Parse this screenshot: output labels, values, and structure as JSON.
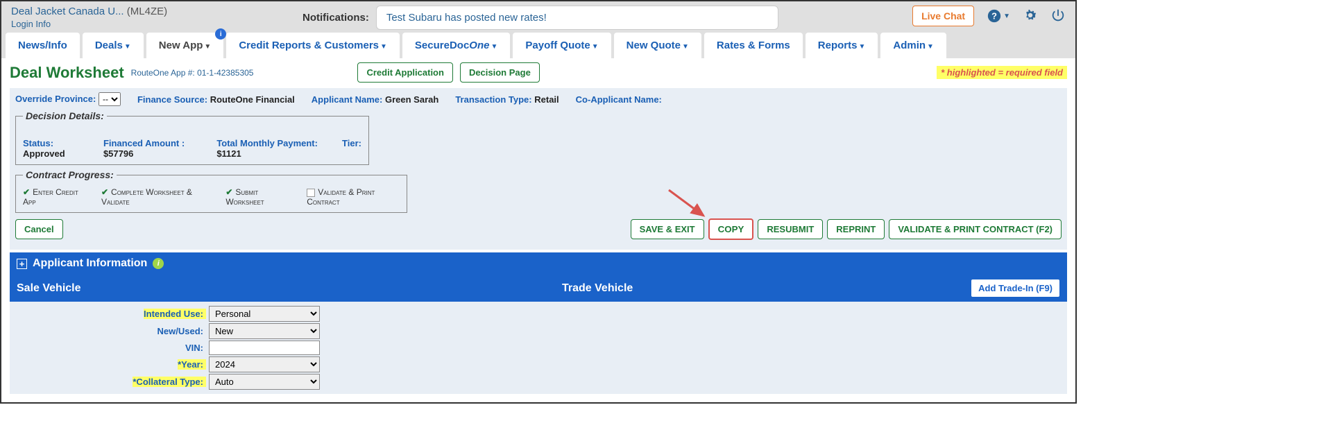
{
  "breadcrumb": {
    "parts": "Deal Jacket Canada U...",
    "code": "(ML4ZE)"
  },
  "login_info": "Login Info",
  "notifications": {
    "label": "Notifications:",
    "text": "Test Subaru has posted new rates!"
  },
  "live_chat": "Live Chat",
  "tabs": {
    "news": "News/Info",
    "deals": "Deals",
    "newapp": "New App",
    "credit": "Credit Reports & Customers",
    "securedoc_prefix": "SecureDoc",
    "securedoc_suffix": "One",
    "payoff": "Payoff Quote",
    "newquote": "New Quote",
    "rates": "Rates & Forms",
    "reports": "Reports",
    "admin": "Admin",
    "badge": "i"
  },
  "page": {
    "title": "Deal Worksheet",
    "appnum_label": "RouteOne App #: ",
    "appnum": "01-1-42385305",
    "credit_app_btn": "Credit Application",
    "decision_btn": "Decision Page",
    "required_note": "* highlighted = required field"
  },
  "strip": {
    "override_label": "Override Province:",
    "override_val": "--",
    "fs_label": "Finance Source:",
    "fs_val": "RouteOne Financial",
    "applicant_label": "Applicant Name:",
    "applicant_val": "Green Sarah",
    "ttype_label": "Transaction Type:",
    "ttype_val": "Retail",
    "coapp_label": "Co-Applicant Name:",
    "coapp_val": ""
  },
  "decision": {
    "legend": "Decision Details:",
    "status_label": "Status:",
    "status_val": "Approved",
    "financed_label": "Financed Amount :",
    "financed_val": "$57796",
    "monthly_label": "Total Monthly Payment:",
    "monthly_val": "$1121",
    "tier_label": "Tier:",
    "tier_val": ""
  },
  "progress": {
    "legend": "Contract Progress:",
    "s1": "Enter Credit App",
    "s2": "Complete Worksheet & Validate",
    "s3": "Submit Worksheet",
    "s4": "Validate & Print Contract"
  },
  "actions": {
    "cancel": "Cancel",
    "save_exit": "SAVE & EXIT",
    "copy": "COPY",
    "resubmit": "RESUBMIT",
    "reprint": "REPRINT",
    "validate": "VALIDATE & PRINT CONTRACT (F2)"
  },
  "applicant_section": {
    "title": "Applicant Information"
  },
  "vehicle": {
    "sale_title": "Sale Vehicle",
    "trade_title": "Trade Vehicle",
    "add_trade": "Add Trade-In (F9)",
    "intended_use_label": "Intended Use:",
    "intended_use_val": "Personal",
    "new_used_label": "New/Used:",
    "new_used_val": "New",
    "vin_label": "VIN:",
    "vin_val": "",
    "year_label": "*Year:",
    "year_val": "2024",
    "collateral_label": "*Collateral Type:",
    "collateral_val": "Auto"
  }
}
